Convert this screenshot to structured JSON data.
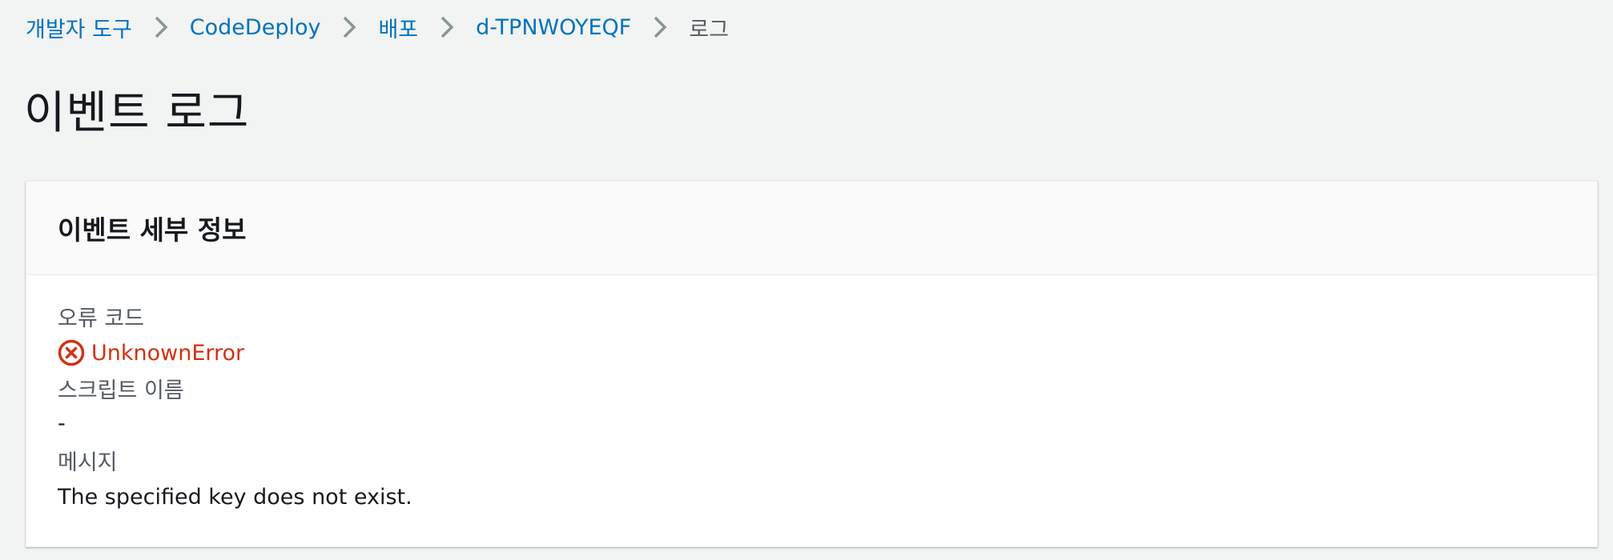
{
  "breadcrumb": {
    "items": [
      {
        "label": "개발자 도구"
      },
      {
        "label": "CodeDeploy"
      },
      {
        "label": "배포"
      },
      {
        "label": "d-TPNWOYEQF"
      },
      {
        "label": "로그"
      }
    ]
  },
  "page": {
    "title": "이벤트 로그"
  },
  "panel": {
    "title": "이벤트 세부 정보",
    "fields": {
      "error_code": {
        "label": "오류 코드",
        "value": "UnknownError",
        "icon": "error-circle-x-icon"
      },
      "script_name": {
        "label": "스크립트 이름",
        "value": "-"
      },
      "message": {
        "label": "메시지",
        "value": "The specified key does not exist."
      }
    }
  },
  "colors": {
    "link": "#0073bb",
    "error": "#d13212",
    "background": "#f2f3f3",
    "panel_header": "#fafafa",
    "label": "#545b64",
    "text": "#16191f"
  }
}
